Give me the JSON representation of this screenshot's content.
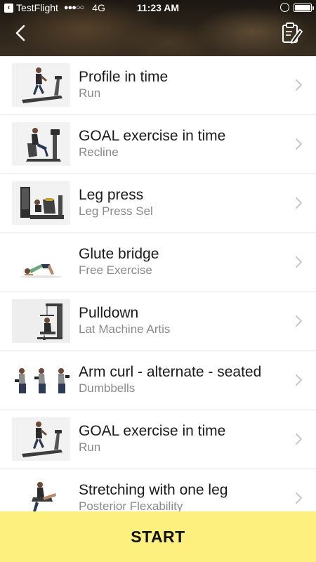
{
  "status_bar": {
    "carrier": "TestFlight",
    "signal": "●●●○○",
    "network": "4G",
    "time": "11:23 AM"
  },
  "header": {
    "back_icon": "chevron-left-icon",
    "notes_icon": "clipboard-edit-icon"
  },
  "exercises": [
    {
      "title": "Profile in time",
      "subtitle": "Run",
      "thumbnail": "treadmill"
    },
    {
      "title": "GOAL exercise in time",
      "subtitle": "Recline",
      "thumbnail": "recumbent-bike"
    },
    {
      "title": "Leg press",
      "subtitle": "Leg Press Sel",
      "thumbnail": "leg-press-machine"
    },
    {
      "title": "Glute bridge",
      "subtitle": "Free Exercise",
      "thumbnail": "floor-exercise"
    },
    {
      "title": "Pulldown",
      "subtitle": "Lat Machine Artis",
      "thumbnail": "lat-machine"
    },
    {
      "title": "Arm curl - alternate - seated",
      "subtitle": "Dumbbells",
      "thumbnail": "dumbbell-curl"
    },
    {
      "title": "GOAL exercise in time",
      "subtitle": "Run",
      "thumbnail": "treadmill"
    },
    {
      "title": "Stretching with one leg",
      "subtitle": "Posterior Flexability",
      "thumbnail": "stretching"
    }
  ],
  "start_button": {
    "label": "START",
    "color": "#fdf07e"
  },
  "colors": {
    "title": "#1a1a1a",
    "subtitle": "#8a8a8a",
    "chevron": "#c7c7cc"
  }
}
